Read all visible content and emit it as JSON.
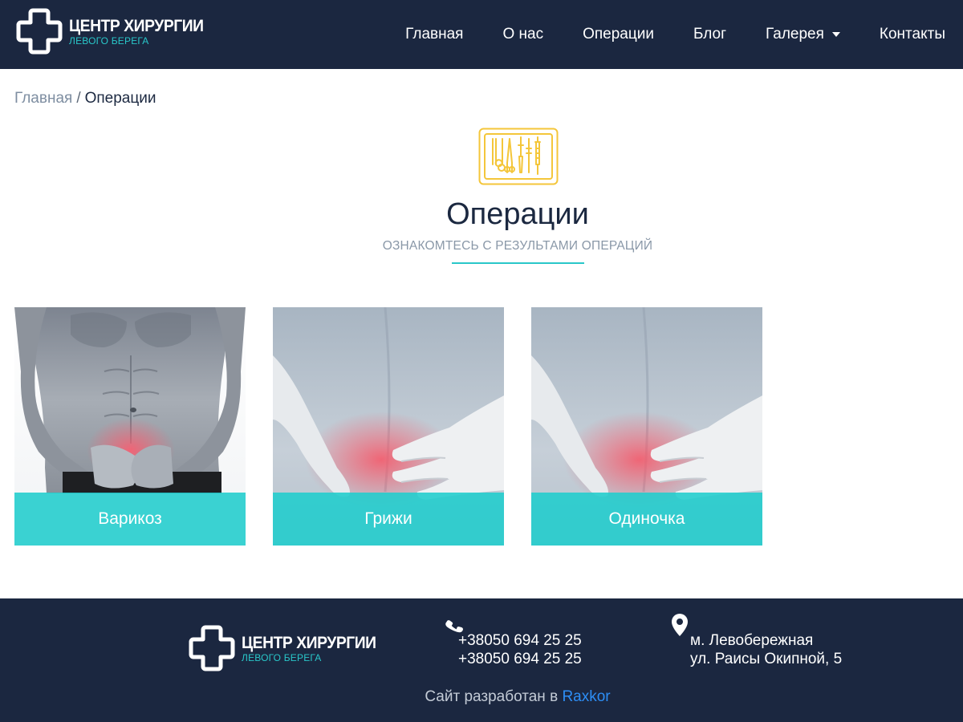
{
  "header": {
    "logo": {
      "title": "ЦЕНТР ХИРУРГИИ",
      "subtitle": "ЛЕВОГО БЕРЕГА",
      "icon": "cross-logo-icon"
    },
    "nav": [
      {
        "label": "Главная"
      },
      {
        "label": "О нас"
      },
      {
        "label": "Операции"
      },
      {
        "label": "Блог"
      },
      {
        "label": "Галерея",
        "has_dropdown": true
      },
      {
        "label": "Контакты"
      }
    ]
  },
  "breadcrumb": {
    "home": "Главная",
    "separator": "/",
    "current": "Операции"
  },
  "section": {
    "icon": "surgical-tools-icon",
    "title": "Операции",
    "subtitle": "ОЗНАКОМТЕСЬ С РЕЗУЛЬТАМИ ОПЕРАЦИЙ"
  },
  "cards": [
    {
      "label": "Варикоз",
      "image": "male-torso-photo"
    },
    {
      "label": "Грижи",
      "image": "lower-back-pain-photo"
    },
    {
      "label": "Одиночка",
      "image": "lower-back-pain-photo"
    }
  ],
  "footer": {
    "logo": {
      "title": "ЦЕНТР ХИРУРГИИ",
      "subtitle": "ЛЕВОГО БЕРЕГА"
    },
    "phones": [
      "+38050 694 25 25",
      "+38050 694 25 25"
    ],
    "address": [
      "м. Левобережная",
      "ул. Раисы Окипной, 5"
    ],
    "credit_text": "Сайт разработан в",
    "credit_link": "Raxkor"
  },
  "colors": {
    "navy": "#1b2740",
    "accent": "#29c7c9",
    "gold": "#f4c63a",
    "link": "#2d8ef5"
  }
}
